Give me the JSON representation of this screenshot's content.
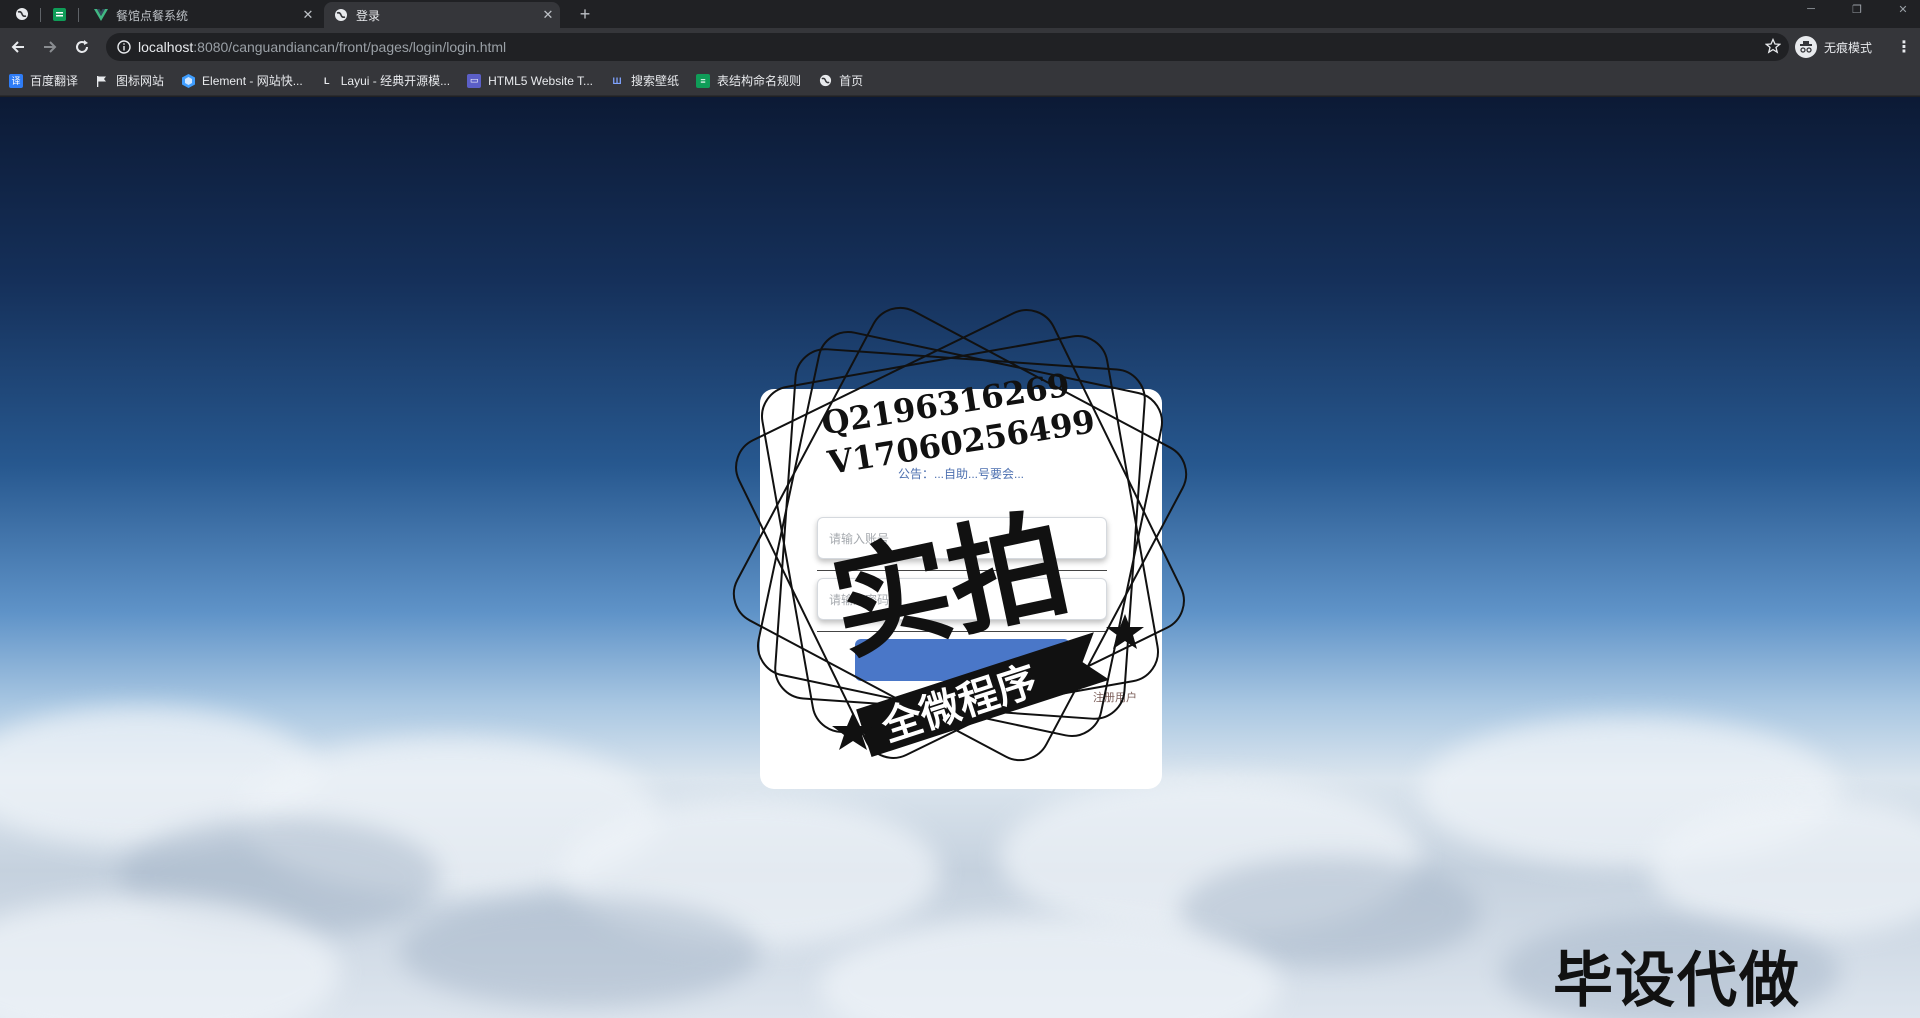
{
  "browser": {
    "tabs": [
      {
        "title": "餐馆点餐系统",
        "active": false
      },
      {
        "title": "登录",
        "active": true
      }
    ],
    "address": {
      "host": "localhost",
      "path": ":8080/canguandiancan/front/pages/login/login.html"
    },
    "profile_label": "无痕模式",
    "bookmarks": [
      {
        "label": "百度翻译",
        "icon": "baidu-translate-icon",
        "color": "#2e7cf6"
      },
      {
        "label": "图标网站",
        "icon": "flag-icon",
        "color": "#35363a"
      },
      {
        "label": "Element - 网站快...",
        "icon": "element-icon",
        "color": "#409eff"
      },
      {
        "label": "Layui - 经典开源模...",
        "icon": "layui-icon",
        "color": "#35363a"
      },
      {
        "label": "HTML5 Website T...",
        "icon": "html5-template-icon",
        "color": "#5b5fc7"
      },
      {
        "label": "搜索壁纸",
        "icon": "wallpaper-icon",
        "color": "#3b6fd8"
      },
      {
        "label": "表结构命名规则",
        "icon": "sheet-icon",
        "color": "#0f9d58"
      },
      {
        "label": "首页",
        "icon": "globe-icon",
        "color": "#35363a"
      }
    ]
  },
  "login": {
    "notice": "公告：...自助...号要会...",
    "username_placeholder": "请输入账号",
    "password_placeholder": "请输入密码",
    "login_button": "",
    "register_link": "注册用户"
  },
  "watermark": {
    "contact_q": "Q2196316269",
    "contact_v": "V17060256499",
    "big_text": "实拍",
    "banner_text": "全微程序",
    "corner_text": "毕设代做"
  }
}
